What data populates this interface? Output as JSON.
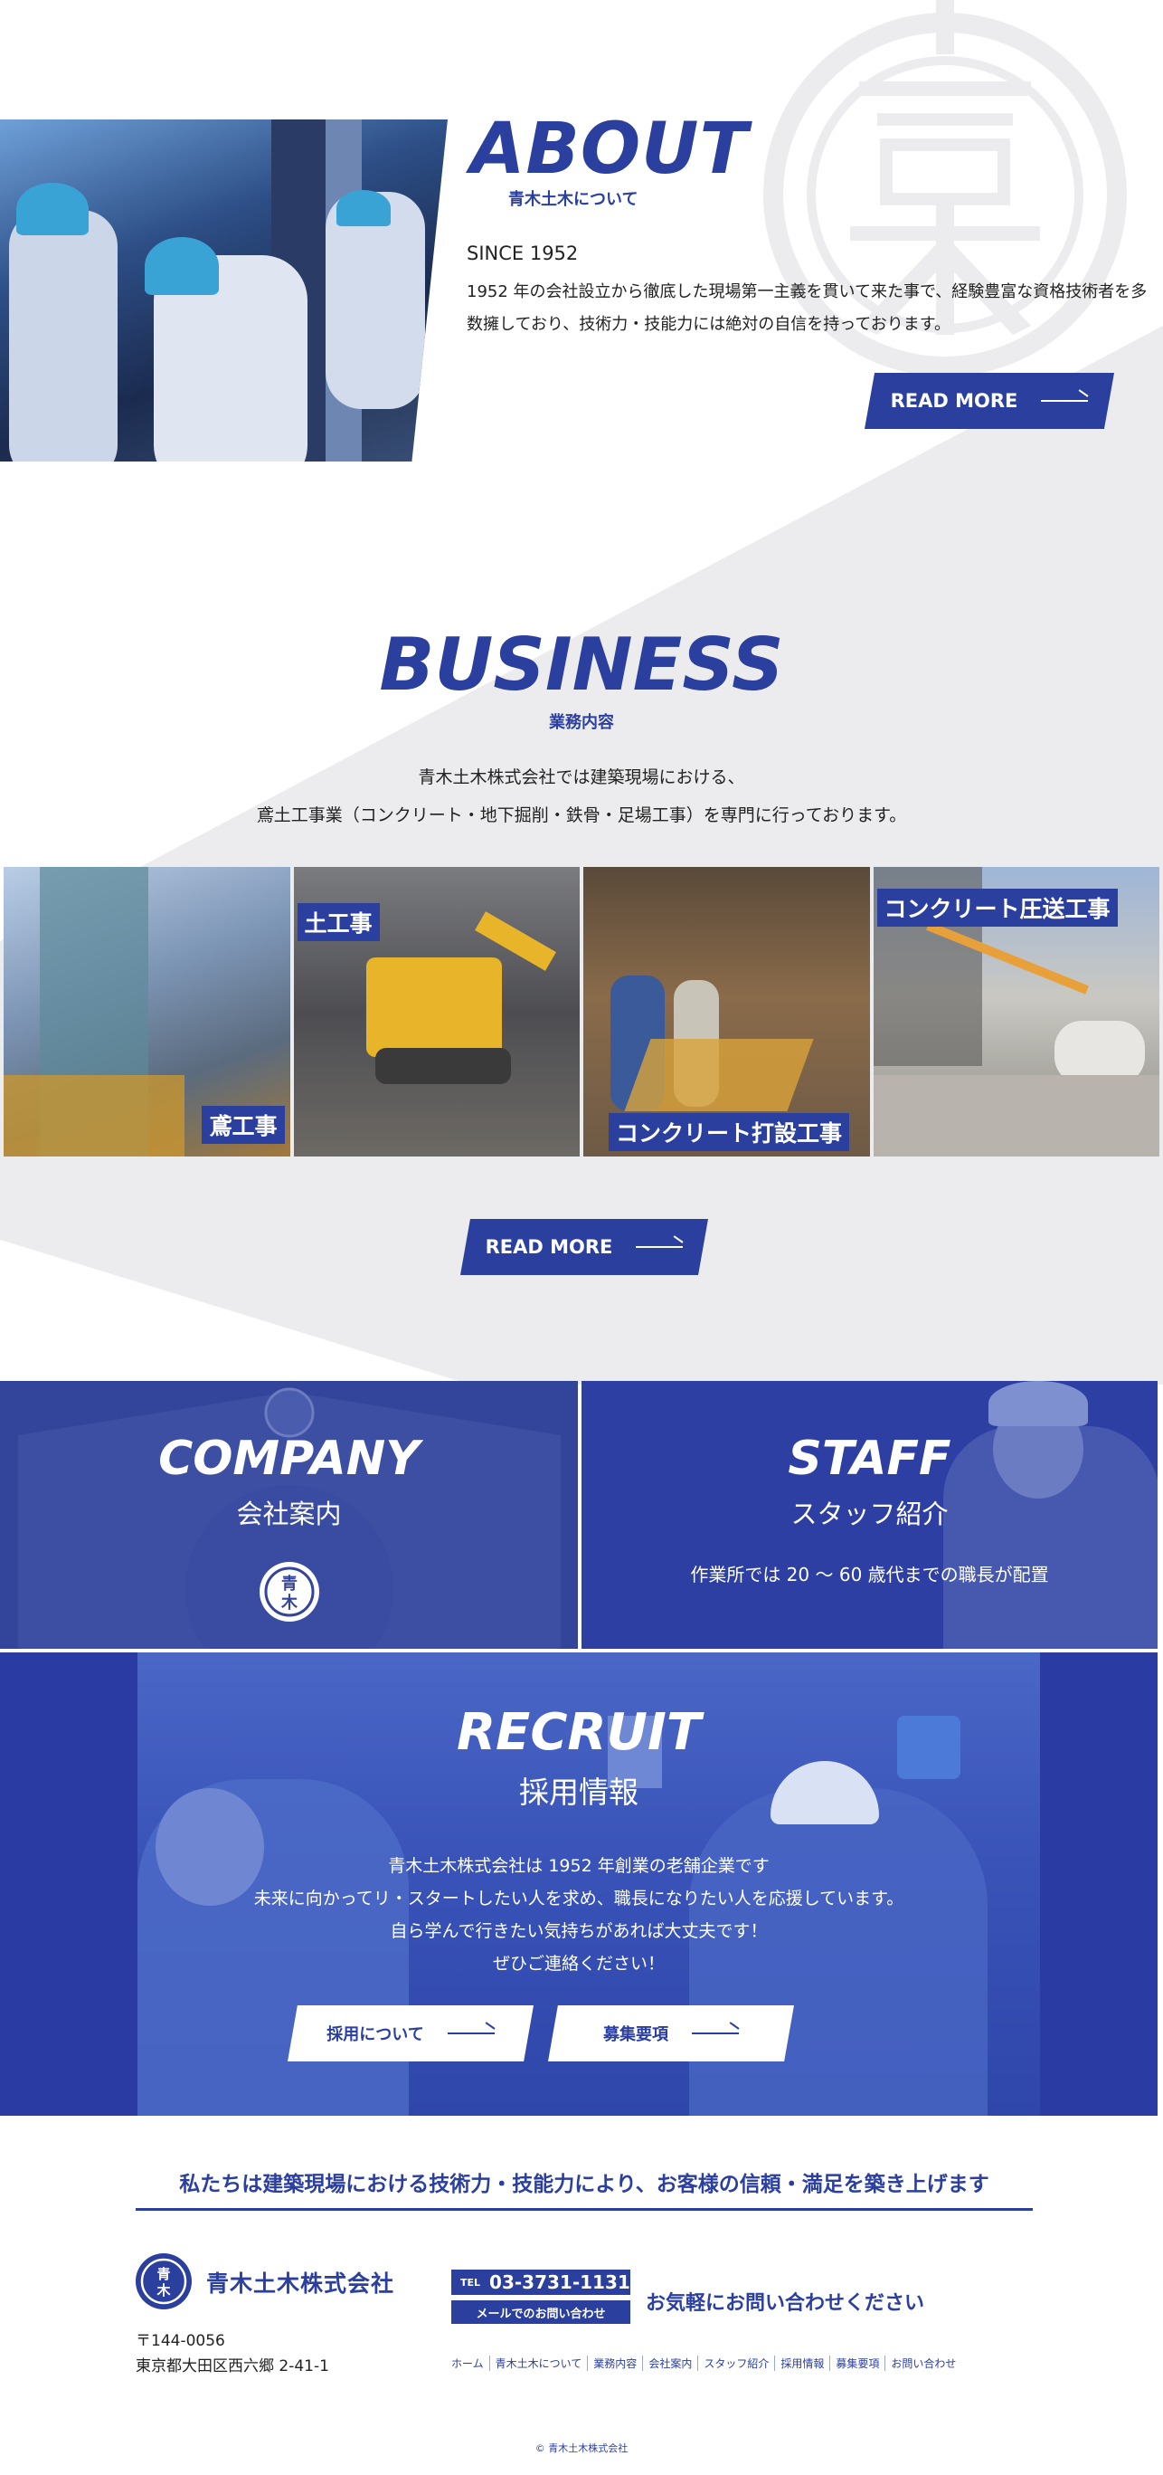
{
  "about": {
    "title": "ABOUT",
    "subtitle": "青木土木について",
    "since": "SINCE 1952",
    "text": "1952 年の会社設立から徹底した現場第一主義を貫いて来た事で、経験豊富な資格技術者を多数擁しており、技術力・技能力には絶対の自信を持っております。",
    "button_label": "READ MORE"
  },
  "business": {
    "title": "BUSINESS",
    "subtitle": "業務内容",
    "text_line1": "青木土木株式会社では建築現場における、",
    "text_line2": "鳶土工事業（コンクリート・地下掘削・鉄骨・足場工事）を専門に行っております。",
    "photos": [
      {
        "label": "鳶工事"
      },
      {
        "label": "土工事"
      },
      {
        "label": "コンクリート打設工事"
      },
      {
        "label": "コンクリート圧送工事"
      }
    ],
    "button_label": "READ MORE"
  },
  "company_panel": {
    "title": "COMPANY",
    "subtitle": "会社案内"
  },
  "staff_panel": {
    "title": "STAFF",
    "subtitle": "スタッフ紹介",
    "text": "作業所では 20 ～ 60 歳代までの職長が配置"
  },
  "recruit": {
    "title": "RECRUIT",
    "subtitle": "採用情報",
    "lines": [
      "青木土木株式会社は 1952 年創業の老舗企業です",
      "未来に向かってリ・スタートしたい人を求め、職長になりたい人を応援しています。",
      "自ら学んで行きたい気持ちがあれば大丈夫です！",
      "ぜひご連絡ください！"
    ],
    "button1_label": "採用について",
    "button2_label": "募集要項"
  },
  "footer": {
    "tagline": "私たちは建築現場における技術力・技能力により、お客様の信頼・満足を築き上げます",
    "company_name": "青木土木株式会社",
    "logo_chars": [
      "青",
      "木"
    ],
    "postal": "〒144-0056",
    "address": "東京都大田区西六郷 2-41-1",
    "tel_label": "TEL",
    "tel_number": "03-3731-1131",
    "mail_label": "メールでのお問い合わせ",
    "contact_message": "お気軽にお問い合わせください",
    "nav": [
      "ホーム",
      "青木土木について",
      "業務内容",
      "会社案内",
      "スタッフ紹介",
      "採用情報",
      "募集要項",
      "お問い合わせ"
    ],
    "copyright": "© 青木土木株式会社"
  },
  "colors": {
    "brand_blue": "#2b3f9e",
    "light_gray_bg": "#ececee",
    "white": "#ffffff"
  }
}
